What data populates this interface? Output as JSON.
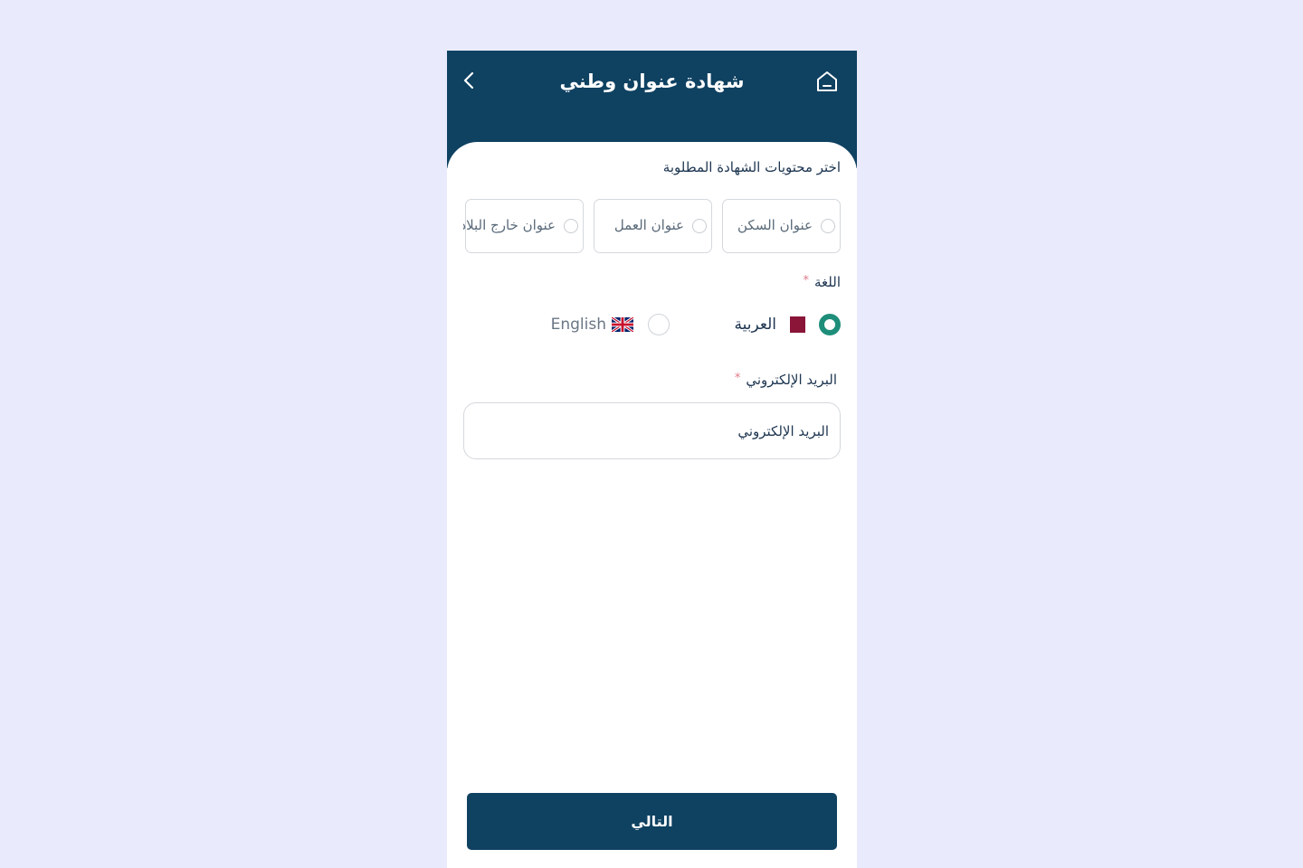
{
  "header": {
    "title": "شهادة عنوان وطني",
    "back_icon": "chevron-left-icon",
    "home_icon": "home-icon"
  },
  "contents": {
    "label": "اختر محتويات الشهادة المطلوبة",
    "options": [
      {
        "label": "عنوان السكن",
        "selected": false
      },
      {
        "label": "عنوان العمل",
        "selected": false
      },
      {
        "label": "عنوان خارج البلاد",
        "selected": false
      }
    ]
  },
  "language": {
    "label": "اللغة",
    "required_mark": "*",
    "options": [
      {
        "label": "العربية",
        "selected": true,
        "flag_icon": "qatar-flag-icon"
      },
      {
        "label": "English",
        "selected": false,
        "flag_icon": "uk-flag-icon"
      }
    ]
  },
  "email": {
    "label": "البريد الإلكتروني",
    "required_mark": "*",
    "placeholder": "البريد الإلكتروني",
    "value": ""
  },
  "footer": {
    "next_label": "التالي"
  },
  "colors": {
    "primary": "#0f4161",
    "accent": "#1e8e7a",
    "background": "#e9eafb"
  }
}
